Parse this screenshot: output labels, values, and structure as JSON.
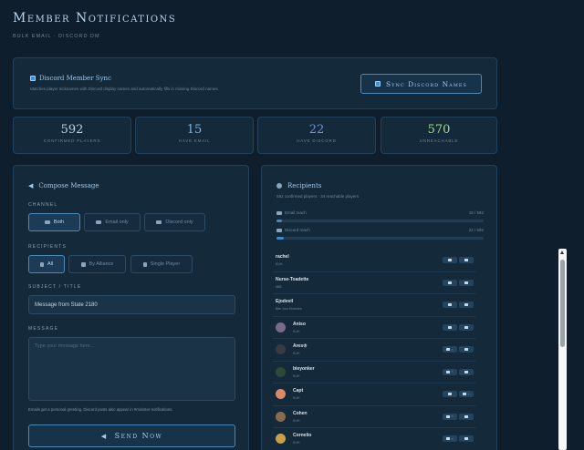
{
  "page": {
    "title": "Member Notifications",
    "subtitle": "Bulk email · Discord DM"
  },
  "sync": {
    "title": "Discord Member Sync",
    "description": "Matches player nicknames with Discord display names and automatically fills in missing Discord names.",
    "button_label": "Sync Discord Names"
  },
  "stats": [
    {
      "value": "592",
      "label": "Confirmed Players",
      "color": "#bcd3e6"
    },
    {
      "value": "15",
      "label": "Have Email",
      "color": "#7fb3dd"
    },
    {
      "value": "22",
      "label": "Have Discord",
      "color": "#6f94d8"
    },
    {
      "value": "570",
      "label": "Unreachable",
      "color": "#9fdc8a"
    }
  ],
  "compose": {
    "title": "Compose Message",
    "channel_label": "Channel",
    "channel_options": [
      {
        "label": "Both",
        "active": true
      },
      {
        "label": "Email only",
        "active": false
      },
      {
        "label": "Discord only",
        "active": false
      }
    ],
    "recipients_label": "Recipients",
    "recipient_options": [
      {
        "label": "All",
        "active": true
      },
      {
        "label": "By Alliance",
        "active": false
      },
      {
        "label": "Single Player",
        "active": false
      }
    ],
    "subject_label": "Subject / Title",
    "subject_value": "Message from State 2180",
    "message_label": "Message",
    "message_placeholder": "Type your message here...",
    "hint": "Emails get a personal greeting. Discord posts also appear in #minister-notifications.",
    "send_label": "Send Now"
  },
  "recipients": {
    "title": "Recipients",
    "subtitle": "592 confirmed players · 34 reachable players",
    "email_reach": {
      "label": "Email reach",
      "count": "15 / 592",
      "fraction": 0.025
    },
    "discord_reach": {
      "label": "Discord reach",
      "count": "22 / 592",
      "fraction": 0.037
    },
    "list": [
      {
        "name": "rachel",
        "tag": "KUH",
        "avatar": null,
        "email": true,
        "discord": true
      },
      {
        "name": "Nurse-Toadette",
        "tag": "NkB",
        "avatar": null,
        "email": true,
        "discord": true
      },
      {
        "name": "Ejodevil",
        "tag": "Bite Your Enemies",
        "avatar": null,
        "email": true,
        "discord": true
      },
      {
        "name": "Aniso",
        "tag": "KUH",
        "avatar": "#7a6a8a",
        "email": true,
        "discord": true
      },
      {
        "name": "Ares♔",
        "tag": "KUH",
        "avatar": "#3a3a42",
        "email": false,
        "discord": true
      },
      {
        "name": "bieyonker",
        "tag": "KUH",
        "avatar": "#2d4a3a",
        "email": false,
        "discord": true
      },
      {
        "name": "Capt",
        "tag": "KUH",
        "avatar": "#d88a6a",
        "email": true,
        "discord": false
      },
      {
        "name": "Cohen",
        "tag": "KUH",
        "avatar": "#8a6a4a",
        "email": false,
        "discord": true
      },
      {
        "name": "Cornelio",
        "tag": "KUH",
        "avatar": "#c9a04a",
        "email": false,
        "discord": true
      }
    ]
  }
}
